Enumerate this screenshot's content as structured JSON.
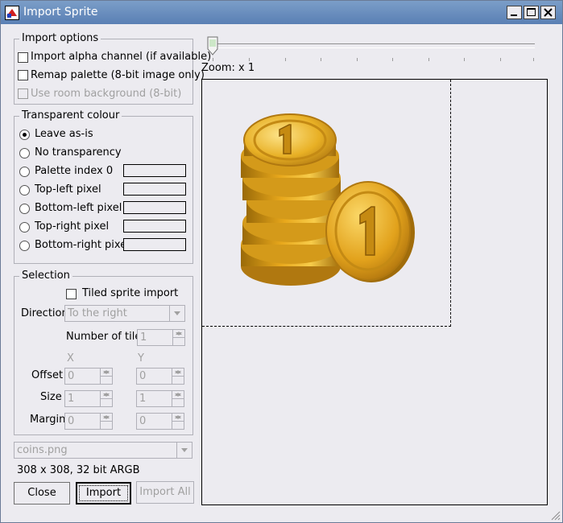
{
  "window": {
    "title": "Import Sprite"
  },
  "import_options": {
    "title": "Import options",
    "alpha_label": "Import alpha channel (if available)",
    "remap_label": "Remap palette (8-bit image only)",
    "room_bg_label": "Use room background (8-bit)"
  },
  "transparent": {
    "title": "Transparent colour",
    "options": [
      "Leave as-is",
      "No transparency",
      "Palette index 0",
      "Top-left pixel",
      "Bottom-left pixel",
      "Top-right pixel",
      "Bottom-right pixel"
    ],
    "selected": "Leave as-is"
  },
  "selection": {
    "title": "Selection",
    "tiled_label": "Tiled sprite import",
    "direction_label": "Direction",
    "direction_value": "To the right",
    "num_tiles_label": "Number of tiles",
    "num_tiles_value": "1",
    "x_header": "X",
    "y_header": "Y",
    "offset_label": "Offset",
    "offset_x": "0",
    "offset_y": "0",
    "size_label": "Size",
    "size_x": "1",
    "size_y": "1",
    "margin_label": "Margin",
    "margin_x": "0",
    "margin_y": "0"
  },
  "file": {
    "name": "coins.png",
    "info": "308 x 308, 32 bit ARGB"
  },
  "buttons": {
    "close": "Close",
    "import": "Import",
    "import_all": "Import All"
  },
  "zoom": {
    "label": "Zoom: x 1",
    "level": 1
  },
  "colors": {
    "titlebar": "#5a7fb4",
    "background": "#ecebf0",
    "coin_gold": "#e8a81c"
  }
}
